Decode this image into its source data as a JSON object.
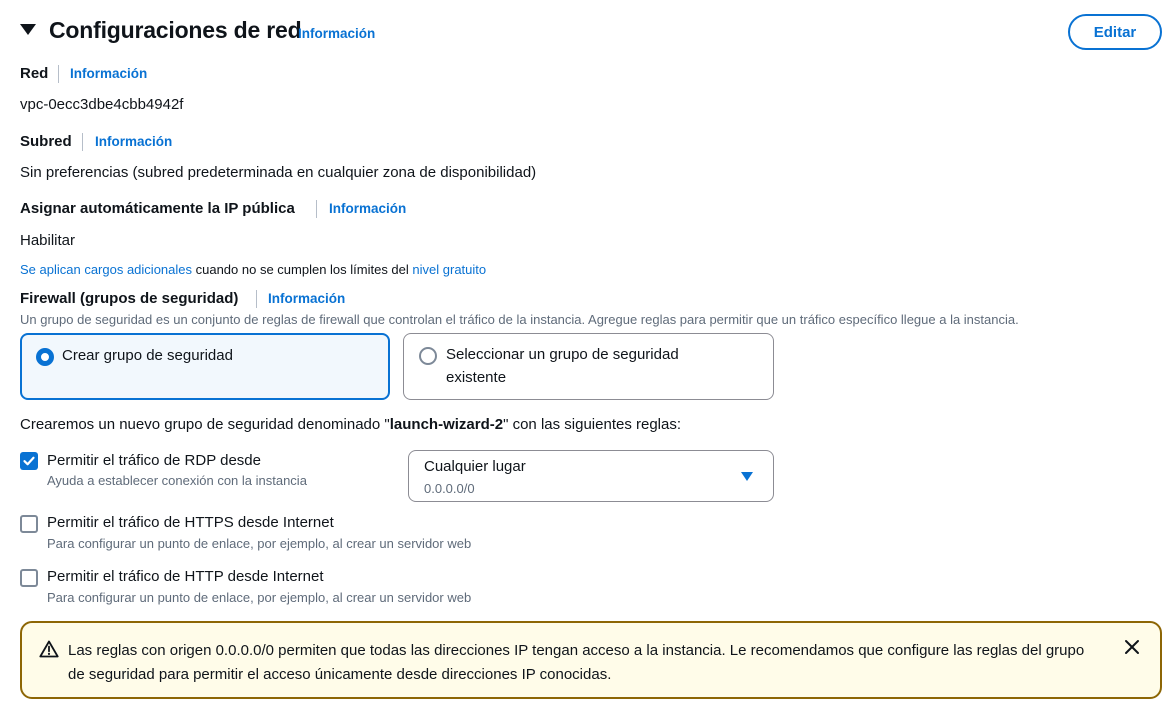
{
  "header": {
    "title": "Configuraciones de red",
    "info": "Información",
    "edit": "Editar"
  },
  "network": {
    "label": "Red",
    "info": "Información",
    "value": "vpc-0ecc3dbe4cbb4942f"
  },
  "subnet": {
    "label": "Subred",
    "info": "Información",
    "value": "Sin preferencias (subred predeterminada en cualquier zona de disponibilidad)"
  },
  "public_ip": {
    "label": "Asignar automáticamente la IP pública",
    "info": "Información",
    "value": "Habilitar",
    "note_link1": "Se aplican cargos adicionales",
    "note_mid": " cuando no se cumplen los límites del ",
    "note_link2": "nivel gratuito"
  },
  "firewall": {
    "label": "Firewall (grupos de seguridad)",
    "info": "Información",
    "description": "Un grupo de seguridad es un conjunto de reglas de firewall que controlan el tráfico de la instancia. Agregue reglas para permitir que un tráfico específico llegue a la instancia.",
    "options": [
      {
        "label": "Crear grupo de seguridad",
        "selected": true
      },
      {
        "label_line1": "Seleccionar un grupo de seguridad",
        "label_line2": "existente",
        "selected": false
      }
    ],
    "new_group_prefix": "Crearemos un nuevo grupo de seguridad denominado \"",
    "new_group_name": "launch-wizard-2",
    "new_group_suffix": "\" con las siguientes reglas:"
  },
  "rules": [
    {
      "label": "Permitir el tráfico de RDP desde",
      "description": "Ayuda a establecer conexión con la instancia",
      "checked": true
    },
    {
      "label": "Permitir el tráfico de HTTPS desde Internet",
      "description": "Para configurar un punto de enlace, por ejemplo, al crear un servidor web",
      "checked": false
    },
    {
      "label": "Permitir el tráfico de HTTP desde Internet",
      "description": "Para configurar un punto de enlace, por ejemplo, al crear un servidor web",
      "checked": false
    }
  ],
  "rdp_source": {
    "selected": "Cualquier lugar",
    "sub": "0.0.0.0/0"
  },
  "warning": {
    "text": "Las reglas con origen 0.0.0.0/0 permiten que todas las direcciones IP tengan acceso a la instancia. Le recomendamos que configure las reglas del grupo de seguridad para permitir el acceso únicamente desde direcciones IP conocidas."
  },
  "colors": {
    "link": "#0972d3",
    "warning_border": "#8d6605",
    "warning_bg": "#fffce9"
  }
}
